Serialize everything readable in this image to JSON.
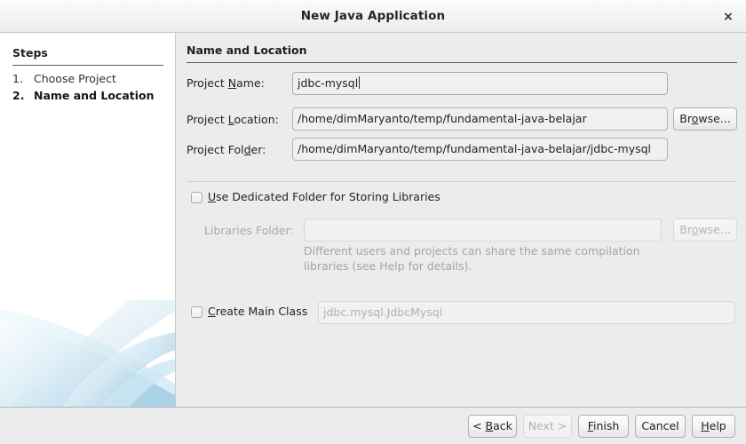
{
  "window": {
    "title": "New Java Application",
    "close_icon": "close-icon",
    "close_glyph": "×"
  },
  "sidebar": {
    "heading": "Steps",
    "steps": [
      {
        "num": "1.",
        "label": "Choose Project",
        "active": false
      },
      {
        "num": "2.",
        "label": "Name and Location",
        "active": true
      }
    ],
    "decoration": "swoosh-graphic"
  },
  "main": {
    "heading": "Name and Location",
    "fields": {
      "project_name": {
        "label_before": "Project ",
        "label_mnemonic": "N",
        "label_after": "ame:",
        "value": "jdbc-mysql"
      },
      "project_location": {
        "label_before": "Project ",
        "label_mnemonic": "L",
        "label_after": "ocation:",
        "value": "/home/dimMaryanto/temp/fundamental-java-belajar",
        "browse_before": "Br",
        "browse_mnemonic": "o",
        "browse_after": "wse..."
      },
      "project_folder": {
        "label_before": "Project Fol",
        "label_mnemonic": "d",
        "label_after": "er:",
        "value": "/home/dimMaryanto/temp/fundamental-java-belajar/jdbc-mysql"
      }
    },
    "dedicated_folder": {
      "checkbox_checked": false,
      "label_mnemonic": "U",
      "label_after": "se Dedicated Folder for Storing Libraries",
      "libraries_label": "Libraries Folder:",
      "libraries_value": "",
      "browse_before": "Br",
      "browse_mnemonic": "o",
      "browse_after": "wse...",
      "hint_line1": "Different users and projects can share the same compilation",
      "hint_line2": "libraries (see Help for details)."
    },
    "main_class": {
      "checkbox_checked": false,
      "label_mnemonic": "C",
      "label_after": "reate Main Class",
      "value": "jdbc.mysql.JdbcMysql"
    }
  },
  "footer": {
    "buttons": [
      {
        "name": "back-button",
        "before": "< ",
        "mnemonic": "B",
        "after": "ack",
        "disabled": false
      },
      {
        "name": "next-button",
        "before": "",
        "mnemonic": "N",
        "after": "ext >",
        "disabled": true,
        "plain": "Next >"
      },
      {
        "name": "finish-button",
        "before": "",
        "mnemonic": "F",
        "after": "inish",
        "disabled": false
      },
      {
        "name": "cancel-button",
        "before": "Cancel",
        "mnemonic": "",
        "after": "",
        "disabled": false
      },
      {
        "name": "help-button",
        "before": "",
        "mnemonic": "H",
        "after": "elp",
        "disabled": false
      }
    ]
  },
  "colors": {
    "window_bg": "#ececec",
    "sidebar_bg": "#ffffff",
    "accent_swoosh": "#bcdcec",
    "text": "#242424",
    "disabled_text": "#a8a8a8"
  }
}
